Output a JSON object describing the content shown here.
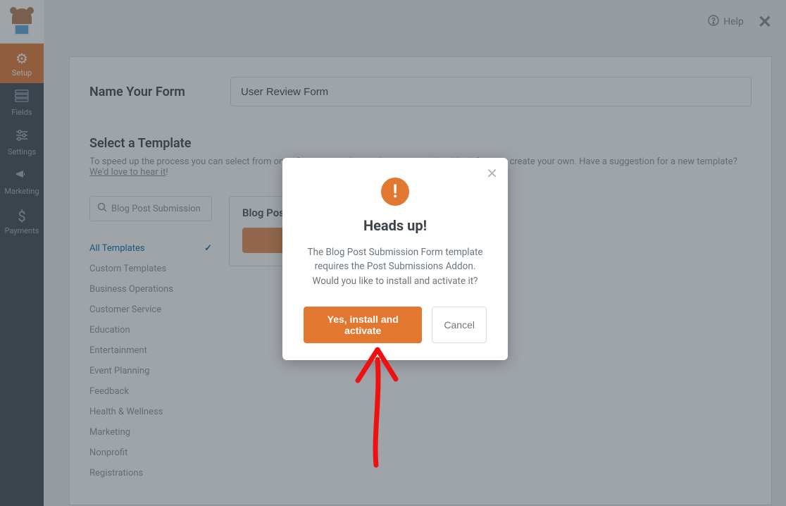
{
  "topbar": {
    "help_label": "Help"
  },
  "sidebar": {
    "items": [
      {
        "label": "Setup"
      },
      {
        "label": "Fields"
      },
      {
        "label": "Settings"
      },
      {
        "label": "Marketing"
      },
      {
        "label": "Payments"
      }
    ]
  },
  "form": {
    "name_label": "Name Your Form",
    "name_value": "User Review Form"
  },
  "template_section": {
    "title": "Select a Template",
    "description_prefix": "To speed up the process you can select from one of our pre-made templates, start with a blank form, or create your own. Have a suggestion for a new template? ",
    "description_link": "We'd love to hear it",
    "description_suffix": "!"
  },
  "search": {
    "value": "Blog Post Submission"
  },
  "categories": [
    "All Templates",
    "Custom Templates",
    "Business Operations",
    "Customer Service",
    "Education",
    "Entertainment",
    "Event Planning",
    "Feedback",
    "Health & Wellness",
    "Marketing",
    "Nonprofit",
    "Registrations"
  ],
  "template_card": {
    "title": "Blog Post Submission Form"
  },
  "modal": {
    "title": "Heads up!",
    "text": "The Blog Post Submission Form template requires the Post Submissions Addon. Would you like to install and activate it?",
    "confirm_label": "Yes, install and activate",
    "cancel_label": "Cancel"
  }
}
